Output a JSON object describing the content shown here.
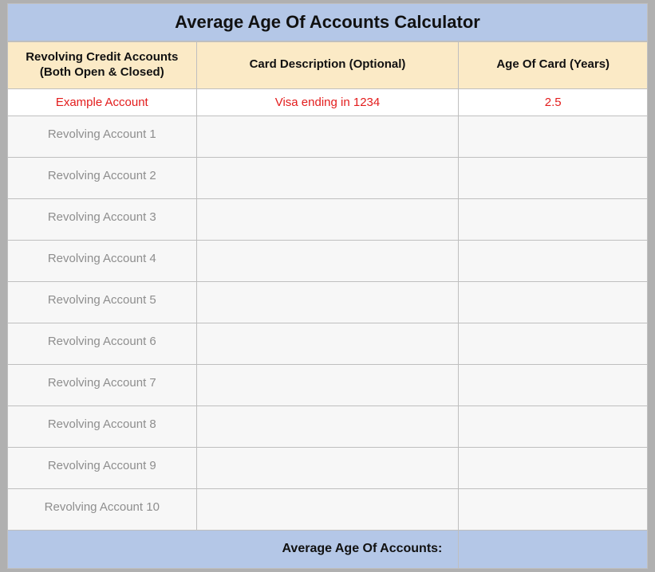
{
  "title": "Average Age Of Accounts Calculator",
  "headers": {
    "col1_line1": "Revolving Credit Accounts",
    "col1_line2": "(Both Open & Closed)",
    "col2": "Card Description (Optional)",
    "col3": "Age Of Card (Years)"
  },
  "example": {
    "account": "Example Account",
    "description": "Visa ending in 1234",
    "age": "2.5"
  },
  "rows": [
    {
      "placeholder": "Revolving Account 1"
    },
    {
      "placeholder": "Revolving Account 2"
    },
    {
      "placeholder": "Revolving Account 3"
    },
    {
      "placeholder": "Revolving Account 4"
    },
    {
      "placeholder": "Revolving Account 5"
    },
    {
      "placeholder": "Revolving Account 6"
    },
    {
      "placeholder": "Revolving Account 7"
    },
    {
      "placeholder": "Revolving Account 8"
    },
    {
      "placeholder": "Revolving Account 9"
    },
    {
      "placeholder": "Revolving Account 10"
    }
  ],
  "footer": {
    "label": "Average Age Of Accounts:",
    "value": ""
  }
}
